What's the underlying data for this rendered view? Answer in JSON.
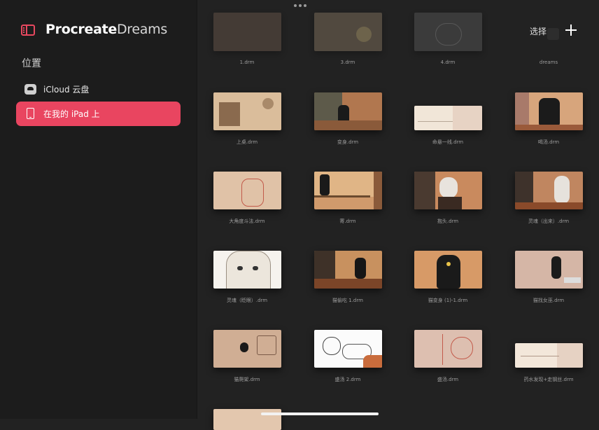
{
  "sidebar": {
    "brand_bold": "Procreate",
    "brand_light": "Dreams",
    "section_title": "位置",
    "locations": [
      {
        "label": "iCloud 云盘",
        "icon": "icloud-drive-icon",
        "active": false
      },
      {
        "label": "在我的 iPad 上",
        "icon": "ipad-icon",
        "active": true
      }
    ],
    "accent_color": "#e94560"
  },
  "header": {
    "select_label": "选择",
    "add_icon": "plus-icon",
    "more_icon": "ellipsis-icon"
  },
  "files": [
    {
      "name": "1.drm"
    },
    {
      "name": "3.drm"
    },
    {
      "name": "4.drm"
    },
    {
      "name": "dreams"
    },
    {
      "name": "上桌.drm"
    },
    {
      "name": "变身.drm"
    },
    {
      "name": "命悬一线.drm"
    },
    {
      "name": "喝汤.drm"
    },
    {
      "name": "大角度斗法.drm"
    },
    {
      "name": "寄.drm"
    },
    {
      "name": "抱头.drm"
    },
    {
      "name": "灵魂（出来）.drm"
    },
    {
      "name": "灵魂（眨眼）.drm"
    },
    {
      "name": "猫偷吃 1.drm"
    },
    {
      "name": "猫变身 (1)-1.drm"
    },
    {
      "name": "猫找女巫.drm"
    },
    {
      "name": "猫爬架.drm"
    },
    {
      "name": "盛汤 2.drm"
    },
    {
      "name": "盛汤.drm"
    },
    {
      "name": "药水发现+走钢丝.drm"
    },
    {
      "name": ""
    }
  ]
}
